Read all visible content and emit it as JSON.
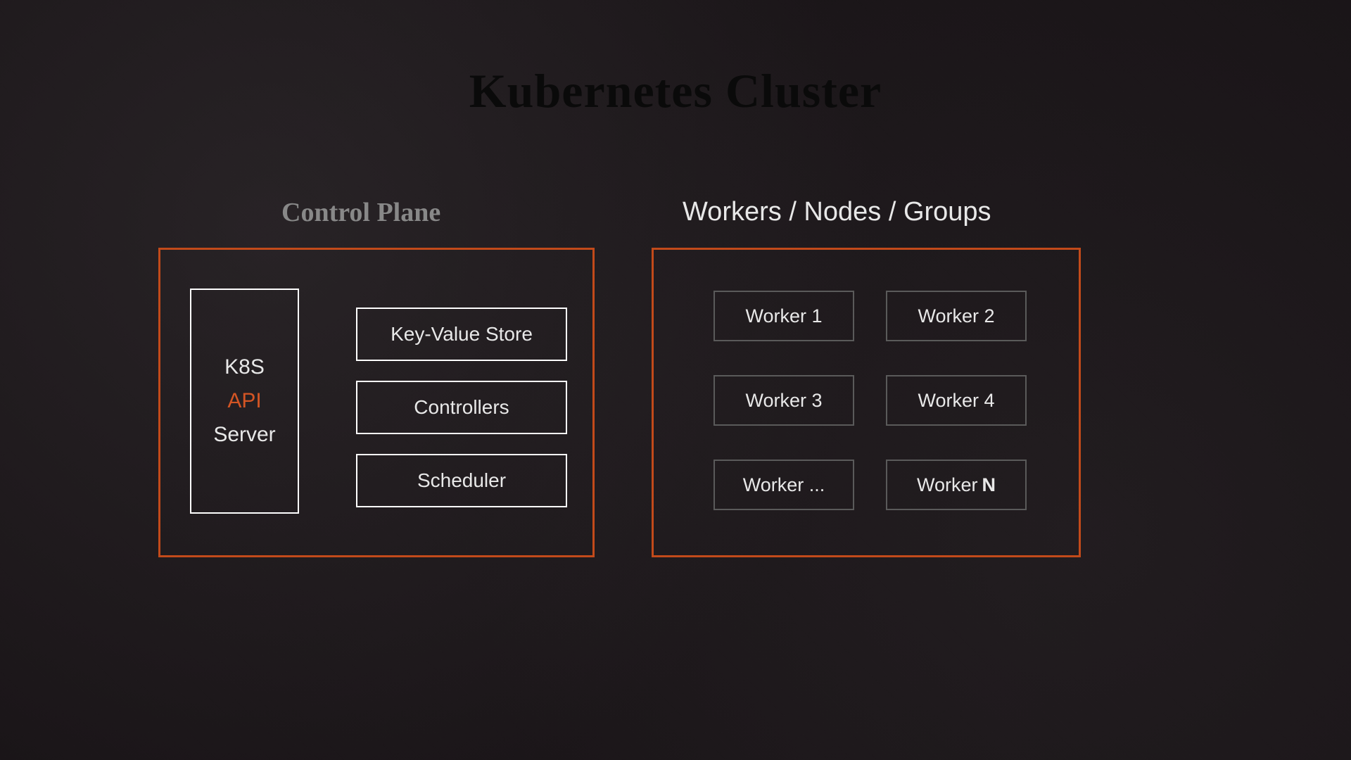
{
  "title": "Kubernetes Cluster",
  "sections": {
    "control": {
      "label": "Control Plane",
      "api": {
        "line1": "K8S",
        "line2": "API",
        "line3": "Server"
      },
      "items": {
        "kv": "Key-Value Store",
        "controllers": "Controllers",
        "scheduler": "Scheduler"
      }
    },
    "workers": {
      "label": "Workers / Nodes / Groups",
      "nodes": {
        "w1": "Worker 1",
        "w2": "Worker 2",
        "w3": "Worker 3",
        "w4": "Worker 4",
        "w5": "Worker ...",
        "w6_prefix": "Worker",
        "w6_suffix": "N"
      }
    }
  },
  "colors": {
    "accent": "#c24a1a",
    "text": "#e8e8e8",
    "muted_border": "#5a5a5a"
  }
}
